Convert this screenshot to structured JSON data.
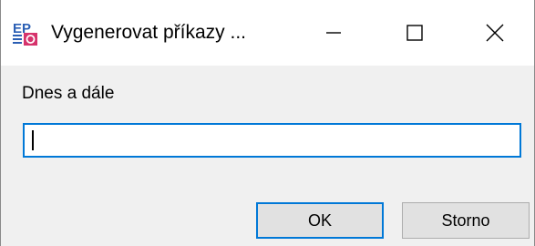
{
  "window": {
    "title": "Vygenerovat příkazy ...",
    "icon": "ep-app-icon",
    "controls": {
      "minimize": "minimize-icon",
      "maximize": "maximize-icon",
      "close": "close-icon"
    }
  },
  "form": {
    "label": "Dnes a dále",
    "input_value": ""
  },
  "buttons": {
    "ok_label": "OK",
    "cancel_label": "Storno"
  },
  "colors": {
    "accent": "#0078d7",
    "icon_red": "#d6336c",
    "icon_blue": "#2b5fb4"
  }
}
